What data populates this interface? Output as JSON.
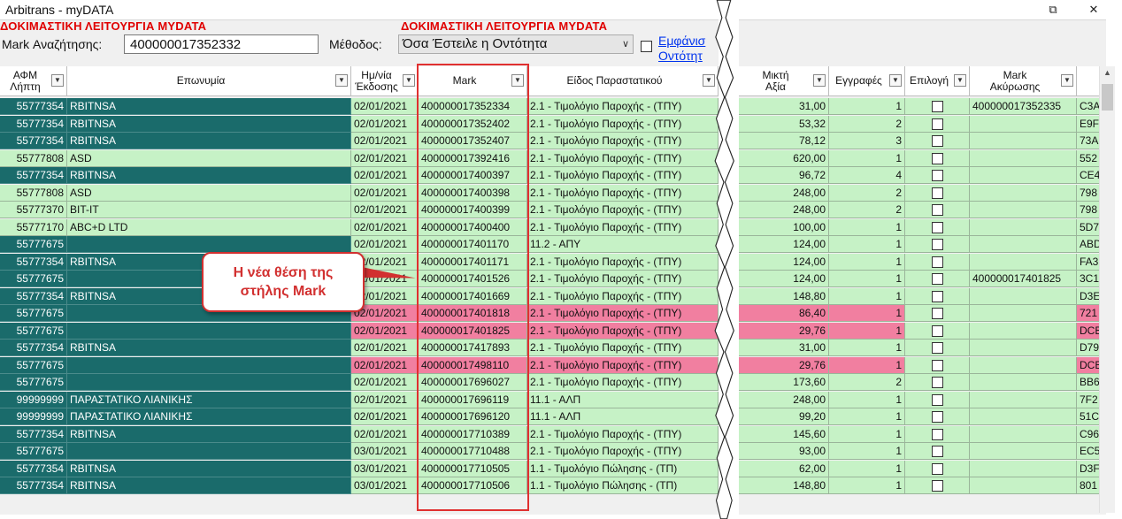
{
  "window": {
    "title": "Arbitrans - myDATA",
    "restore_glyph": "⧉",
    "close_glyph": "✕"
  },
  "banner": {
    "left": "ΔΟΚΙΜΑΣΤΙΚΗ ΛΕΙΤΟΥΡΓΙΑ MYDATA",
    "right": "ΔΟΚΙΜΑΣΤΙΚΗ ΛΕΙΤΟΥΡΓΙΑ MYDATA"
  },
  "filters": {
    "mark_label": "Mark Αναζήτησης:",
    "mark_value": "400000017352332",
    "method_label": "Μέθοδος:",
    "method_value": "Όσα Έστειλε η Οντότητα",
    "show_link_line1": "Εμφάνισ",
    "show_link_line2": "Οντότητ"
  },
  "columns_left": [
    {
      "label": "ΑΦΜ\nΛήπτη"
    },
    {
      "label": "Επωνυμία"
    },
    {
      "label": "Ημ/νία\nΈκδοσης"
    },
    {
      "label": "Mark"
    },
    {
      "label": "Είδος Παραστατικού"
    }
  ],
  "columns_right": [
    {
      "label": "Μικτή\nΑξία"
    },
    {
      "label": "Εγγραφές"
    },
    {
      "label": "Επιλογή"
    },
    {
      "label": "Mark\nΑκύρωσης"
    }
  ],
  "rows": [
    {
      "afm": "55777354",
      "name": "RBITNSA",
      "date": "02/01/2021",
      "mark": "400000017352334",
      "type": "2.1 - Τιμολόγιο Παροχής - (ΤΠΥ)",
      "net": "31,00",
      "entries": "1",
      "cancel": "400000017352335",
      "extra": "C3A",
      "status": "normal"
    },
    {
      "afm": "55777354",
      "name": "RBITNSA",
      "date": "02/01/2021",
      "mark": "400000017352402",
      "type": "2.1 - Τιμολόγιο Παροχής - (ΤΠΥ)",
      "net": "53,32",
      "entries": "2",
      "cancel": "",
      "extra": "E9F",
      "status": "normal"
    },
    {
      "afm": "55777354",
      "name": "RBITNSA",
      "date": "02/01/2021",
      "mark": "400000017352407",
      "type": "2.1 - Τιμολόγιο Παροχής - (ΤΠΥ)",
      "net": "78,12",
      "entries": "3",
      "cancel": "",
      "extra": "73A",
      "status": "normal"
    },
    {
      "afm": "55777808",
      "name": "ASD",
      "date": "02/01/2021",
      "mark": "400000017392416",
      "type": "2.1 - Τιμολόγιο Παροχής - (ΤΠΥ)",
      "net": "620,00",
      "entries": "1",
      "cancel": "",
      "extra": "552",
      "status": "light"
    },
    {
      "afm": "55777354",
      "name": "RBITNSA",
      "date": "02/01/2021",
      "mark": "400000017400397",
      "type": "2.1 - Τιμολόγιο Παροχής - (ΤΠΥ)",
      "net": "96,72",
      "entries": "4",
      "cancel": "",
      "extra": "CE4",
      "status": "normal"
    },
    {
      "afm": "55777808",
      "name": "ASD",
      "date": "02/01/2021",
      "mark": "400000017400398",
      "type": "2.1 - Τιμολόγιο Παροχής - (ΤΠΥ)",
      "net": "248,00",
      "entries": "2",
      "cancel": "",
      "extra": "798",
      "status": "light"
    },
    {
      "afm": "55777370",
      "name": "BIT-IT",
      "date": "02/01/2021",
      "mark": "400000017400399",
      "type": "2.1 - Τιμολόγιο Παροχής - (ΤΠΥ)",
      "net": "248,00",
      "entries": "2",
      "cancel": "",
      "extra": "798",
      "status": "light"
    },
    {
      "afm": "55777170",
      "name": "ABC+D LTD",
      "date": "02/01/2021",
      "mark": "400000017400400",
      "type": "2.1 - Τιμολόγιο Παροχής - (ΤΠΥ)",
      "net": "100,00",
      "entries": "1",
      "cancel": "",
      "extra": "5D7",
      "status": "light"
    },
    {
      "afm": "55777675",
      "name": "",
      "date": "02/01/2021",
      "mark": "400000017401170",
      "type": "11.2 - ΑΠΥ",
      "net": "124,00",
      "entries": "1",
      "cancel": "",
      "extra": "ABD",
      "status": "normal"
    },
    {
      "afm": "55777354",
      "name": "RBITNSA",
      "date": "02/01/2021",
      "mark": "400000017401171",
      "type": "2.1 - Τιμολόγιο Παροχής - (ΤΠΥ)",
      "net": "124,00",
      "entries": "1",
      "cancel": "",
      "extra": "FA3",
      "status": "normal"
    },
    {
      "afm": "55777675",
      "name": "",
      "date": "02/01/2021",
      "mark": "400000017401526",
      "type": "2.1 - Τιμολόγιο Παροχής - (ΤΠΥ)",
      "net": "124,00",
      "entries": "1",
      "cancel": "400000017401825",
      "extra": "3C1",
      "status": "normal"
    },
    {
      "afm": "55777354",
      "name": "RBITNSA",
      "date": "02/01/2021",
      "mark": "400000017401669",
      "type": "2.1 - Τιμολόγιο Παροχής - (ΤΠΥ)",
      "net": "148,80",
      "entries": "1",
      "cancel": "",
      "extra": "D3E",
      "status": "normal"
    },
    {
      "afm": "55777675",
      "name": "",
      "date": "02/01/2021",
      "mark": "400000017401818",
      "type": "2.1 - Τιμολόγιο Παροχής - (ΤΠΥ)",
      "net": "86,40",
      "entries": "1",
      "cancel": "",
      "extra": "721",
      "status": "pink"
    },
    {
      "afm": "55777675",
      "name": "",
      "date": "02/01/2021",
      "mark": "400000017401825",
      "type": "2.1 - Τιμολόγιο Παροχής - (ΤΠΥ)",
      "net": "29,76",
      "entries": "1",
      "cancel": "",
      "extra": "DCB",
      "status": "pink"
    },
    {
      "afm": "55777354",
      "name": "RBITNSA",
      "date": "02/01/2021",
      "mark": "400000017417893",
      "type": "2.1 - Τιμολόγιο Παροχής - (ΤΠΥ)",
      "net": "31,00",
      "entries": "1",
      "cancel": "",
      "extra": "D79",
      "status": "normal"
    },
    {
      "afm": "55777675",
      "name": "",
      "date": "02/01/2021",
      "mark": "400000017498110",
      "type": "2.1 - Τιμολόγιο Παροχής - (ΤΠΥ)",
      "net": "29,76",
      "entries": "1",
      "cancel": "",
      "extra": "DCB",
      "status": "pink"
    },
    {
      "afm": "55777675",
      "name": "",
      "date": "02/01/2021",
      "mark": "400000017696027",
      "type": "2.1 - Τιμολόγιο Παροχής - (ΤΠΥ)",
      "net": "173,60",
      "entries": "2",
      "cancel": "",
      "extra": "BB6",
      "status": "normal"
    },
    {
      "afm": "99999999",
      "name": "ΠΑΡΑΣΤΑΤΙΚΟ ΛΙΑΝΙΚΗΣ",
      "date": "02/01/2021",
      "mark": "400000017696119",
      "type": "11.1 - ΑΛΠ",
      "net": "248,00",
      "entries": "1",
      "cancel": "",
      "extra": "7F2",
      "status": "normal"
    },
    {
      "afm": "99999999",
      "name": "ΠΑΡΑΣΤΑΤΙΚΟ ΛΙΑΝΙΚΗΣ",
      "date": "02/01/2021",
      "mark": "400000017696120",
      "type": "11.1 - ΑΛΠ",
      "net": "99,20",
      "entries": "1",
      "cancel": "",
      "extra": "51C",
      "status": "normal"
    },
    {
      "afm": "55777354",
      "name": "RBITNSA",
      "date": "02/01/2021",
      "mark": "400000017710389",
      "type": "2.1 - Τιμολόγιο Παροχής - (ΤΠΥ)",
      "net": "145,60",
      "entries": "1",
      "cancel": "",
      "extra": "C96",
      "status": "normal"
    },
    {
      "afm": "55777675",
      "name": "",
      "date": "03/01/2021",
      "mark": "400000017710488",
      "type": "2.1 - Τιμολόγιο Παροχής - (ΤΠΥ)",
      "net": "93,00",
      "entries": "1",
      "cancel": "",
      "extra": "EC5",
      "status": "normal"
    },
    {
      "afm": "55777354",
      "name": "RBITNSA",
      "date": "03/01/2021",
      "mark": "400000017710505",
      "type": "1.1 - Τιμολόγιο Πώλησης - (ΤΠ)",
      "net": "62,00",
      "entries": "1",
      "cancel": "",
      "extra": "D3F",
      "status": "normal"
    },
    {
      "afm": "55777354",
      "name": "RBITNSA",
      "date": "03/01/2021",
      "mark": "400000017710506",
      "type": "1.1 - Τιμολόγιο Πώλησης - (ΤΠ)",
      "net": "148,80",
      "entries": "1",
      "cancel": "",
      "extra": "801",
      "status": "normal"
    }
  ],
  "callout": {
    "text": "Η νέα θέση της\nστήλης Mark"
  },
  "colors": {
    "teal": "#1a6b6b",
    "light_green": "#c6f2c6",
    "pink": "#f17fa0",
    "demo_red": "#e00000",
    "highlight_red": "#e03030"
  },
  "icons": {
    "filter": "filter-dropdown-icon",
    "combo": "chevron-down-icon"
  }
}
